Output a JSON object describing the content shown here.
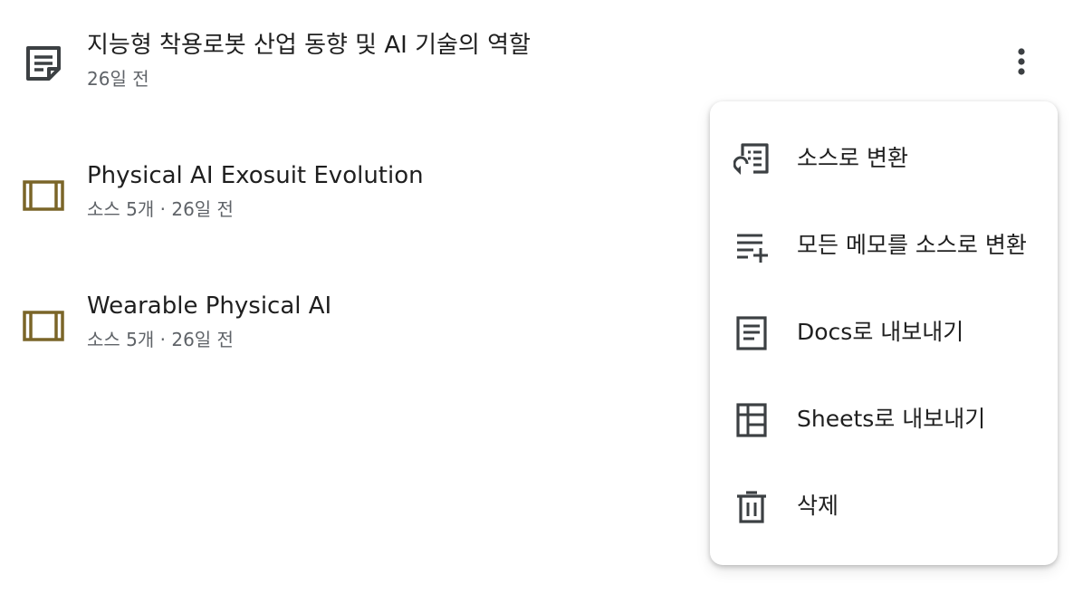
{
  "list": {
    "items": [
      {
        "title": "지능형 착용로봇 산업 동향 및 AI 기술의 역할",
        "subtitle": "26일 전",
        "icon": "note-icon"
      },
      {
        "title": "Physical AI Exosuit Evolution",
        "subtitle": "소스 5개 · 26일 전",
        "icon": "notebook-icon"
      },
      {
        "title": "Wearable Physical AI",
        "subtitle": "소스 5개 · 26일 전",
        "icon": "notebook-icon"
      }
    ]
  },
  "more_button_icon": "more-vert-icon",
  "menu": {
    "items": [
      {
        "label": "소스로 변환",
        "icon": "convert-to-source-icon"
      },
      {
        "label": "모든 메모를 소스로 변환",
        "icon": "playlist-add-icon"
      },
      {
        "label": "Docs로 내보내기",
        "icon": "document-icon"
      },
      {
        "label": "Sheets로 내보내기",
        "icon": "table-icon"
      },
      {
        "label": "삭제",
        "icon": "trash-icon"
      }
    ]
  },
  "colors": {
    "notebook_icon": "#7a6528",
    "icon_dark": "#3c4043",
    "text_primary": "#1f1f1f",
    "text_secondary": "#5f6368"
  }
}
